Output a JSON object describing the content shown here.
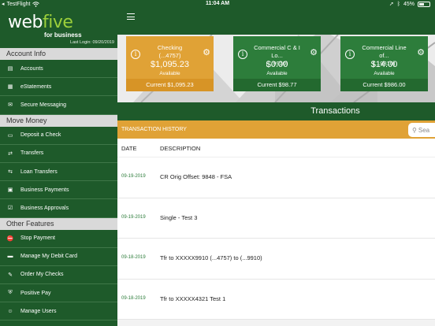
{
  "status_bar": {
    "carrier": "TestFlight",
    "time": "11:04 AM",
    "battery": "45%",
    "battery_level": 0.45
  },
  "brand": {
    "logo_part1": "web",
    "logo_part2": "five",
    "subtitle": "for business",
    "last_login": "Last Login: 09/20/2019",
    "accent": "#9ccf3b"
  },
  "sidebar": {
    "sections": [
      {
        "title": "Account Info",
        "items": [
          {
            "label": "Accounts",
            "icon": "accounts-icon"
          },
          {
            "label": "eStatements",
            "icon": "estatements-icon"
          },
          {
            "label": "Secure Messaging",
            "icon": "mail-icon"
          }
        ]
      },
      {
        "title": "Move Money",
        "items": [
          {
            "label": "Deposit a Check",
            "icon": "deposit-check-icon"
          },
          {
            "label": "Transfers",
            "icon": "transfer-icon"
          },
          {
            "label": "Loan Transfers",
            "icon": "loan-transfer-icon"
          },
          {
            "label": "Business Payments",
            "icon": "business-payments-icon"
          },
          {
            "label": "Business Approvals",
            "icon": "business-approvals-icon"
          }
        ]
      },
      {
        "title": "Other Features",
        "items": [
          {
            "label": "Stop Payment",
            "icon": "stop-payment-icon"
          },
          {
            "label": "Manage My Debit Card",
            "icon": "debit-card-icon"
          },
          {
            "label": "Order My Checks",
            "icon": "order-checks-icon"
          },
          {
            "label": "Positive Pay",
            "icon": "shield-icon"
          },
          {
            "label": "Manage Users",
            "icon": "users-icon"
          }
        ]
      }
    ]
  },
  "accounts": [
    {
      "name": "Checking",
      "number": "(...4757)",
      "amount": "$1,095.23",
      "available_label": "Available",
      "current": "Current $1,095.23",
      "color": "orange"
    },
    {
      "name": "Commercial C & I Lo...",
      "number": "(...9910)",
      "amount": "$0.00",
      "available_label": "Available",
      "current": "Current $98.77",
      "color": "green"
    },
    {
      "name": "Commercial Line of...",
      "number": "(...9810)",
      "amount": "$14.00",
      "available_label": "Available",
      "current": "Current $986.00",
      "color": "green"
    }
  ],
  "transactions": {
    "title": "Transactions",
    "history_label": "TRANSACTION HISTORY",
    "search_placeholder": "Sea",
    "col_date": "DATE",
    "col_desc": "DESCRIPTION",
    "rows": [
      {
        "date": "09-19-2019",
        "description": "CR Orig Offset: 9848 - FSA"
      },
      {
        "date": "09-19-2019",
        "description": "Single - Test 3"
      },
      {
        "date": "09-18-2019",
        "description": "Tfr to XXXXX9910 (...4757) to (...9910)"
      },
      {
        "date": "09-18-2019",
        "description": "Tfr to XXXXX4321 Test 1"
      }
    ]
  }
}
